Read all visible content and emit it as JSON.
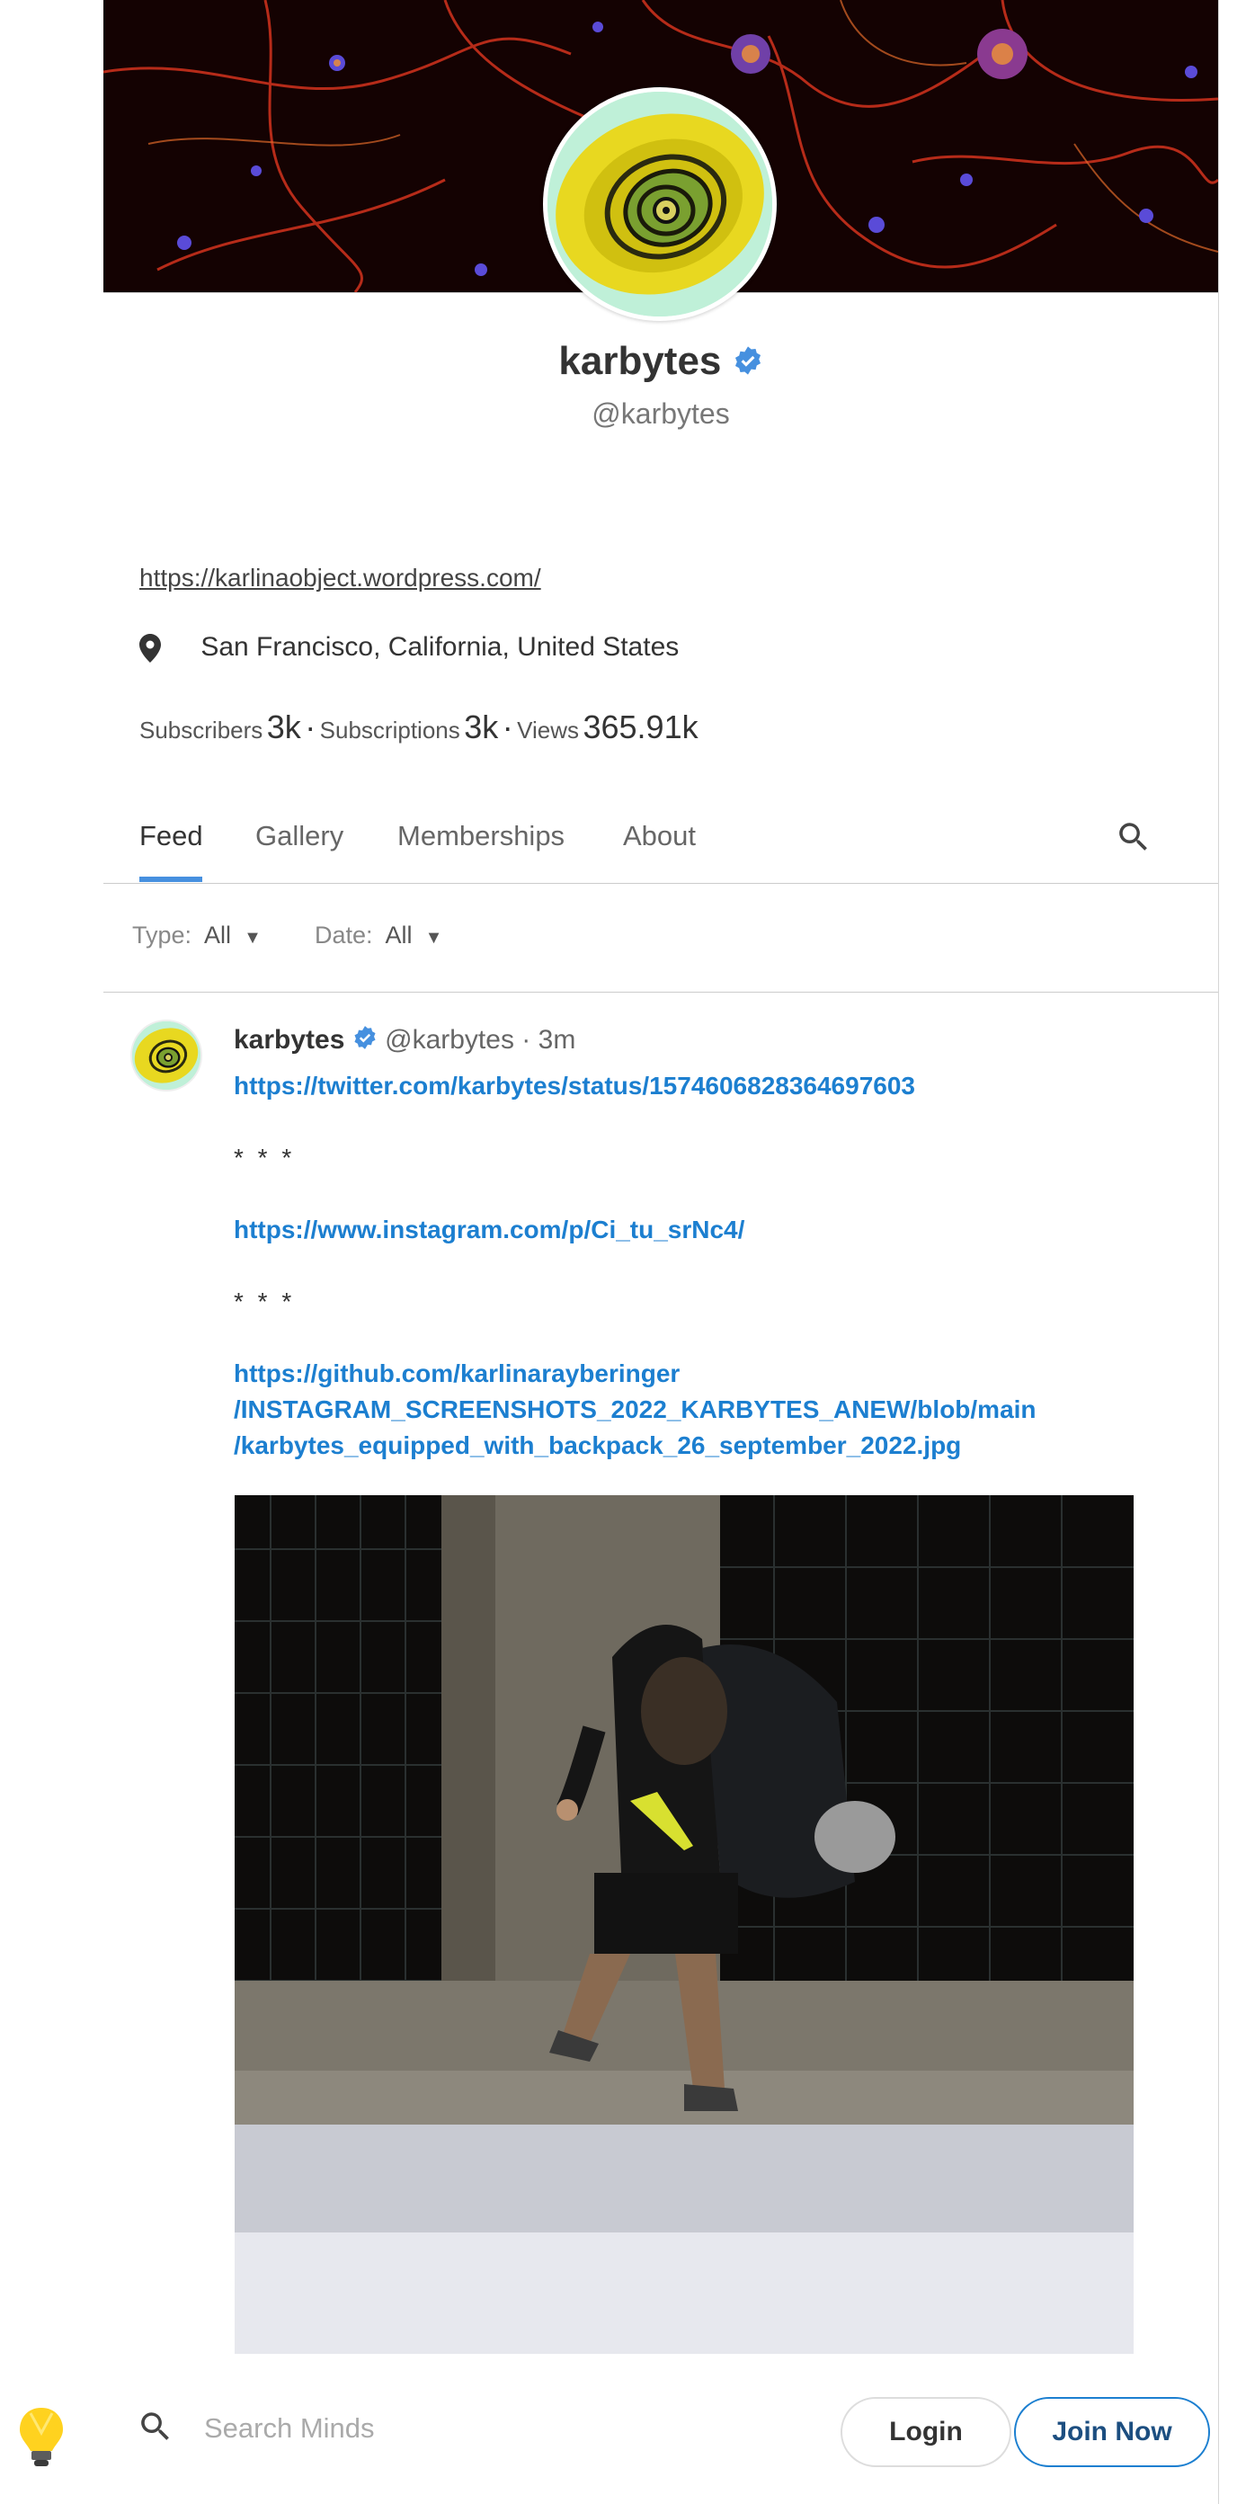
{
  "profile": {
    "display_name": "karbytes",
    "handle": "@karbytes",
    "website": "https://karlinaobject.wordpress.com/",
    "location": "San Francisco, California, United States",
    "stats": {
      "subscribers_label": "Subscribers",
      "subscribers_value": "3k",
      "subscriptions_label": "Subscriptions",
      "subscriptions_value": "3k",
      "views_label": "Views",
      "views_value": "365.91k",
      "separator": "·"
    }
  },
  "tabs": [
    {
      "label": "Feed",
      "active": true
    },
    {
      "label": "Gallery",
      "active": false
    },
    {
      "label": "Memberships",
      "active": false
    },
    {
      "label": "About",
      "active": false
    }
  ],
  "filters": {
    "type_label": "Type:",
    "type_value": "All",
    "date_label": "Date:",
    "date_value": "All",
    "caret": "▼"
  },
  "post": {
    "author": "karbytes",
    "handle": "@karbytes",
    "time": "3m",
    "dot": "·",
    "link1": "https://twitter.com/karbytes/status/1574606828364697603",
    "stars1": "* * *",
    "link2": "https://www.instagram.com/p/Ci_tu_srNc4/",
    "stars2": "* * *",
    "link3_line1": "https://github.com/karlinarayberinger",
    "link3_line2": "/INSTAGRAM_SCREENSHOTS_2022_KARBYTES_ANEW/blob/main",
    "link3_line3": "/karbytes_equipped_with_backpack_26_september_2022.jpg"
  },
  "bottom_bar": {
    "search_placeholder": "Search Minds",
    "login_label": "Login",
    "join_label": "Join Now"
  },
  "colors": {
    "accent": "#4690df",
    "link": "#1c7fd0",
    "verified": "#4690df"
  },
  "icons": [
    "verified-badge-icon",
    "location-pin-icon",
    "search-icon",
    "lightbulb-logo-icon"
  ]
}
